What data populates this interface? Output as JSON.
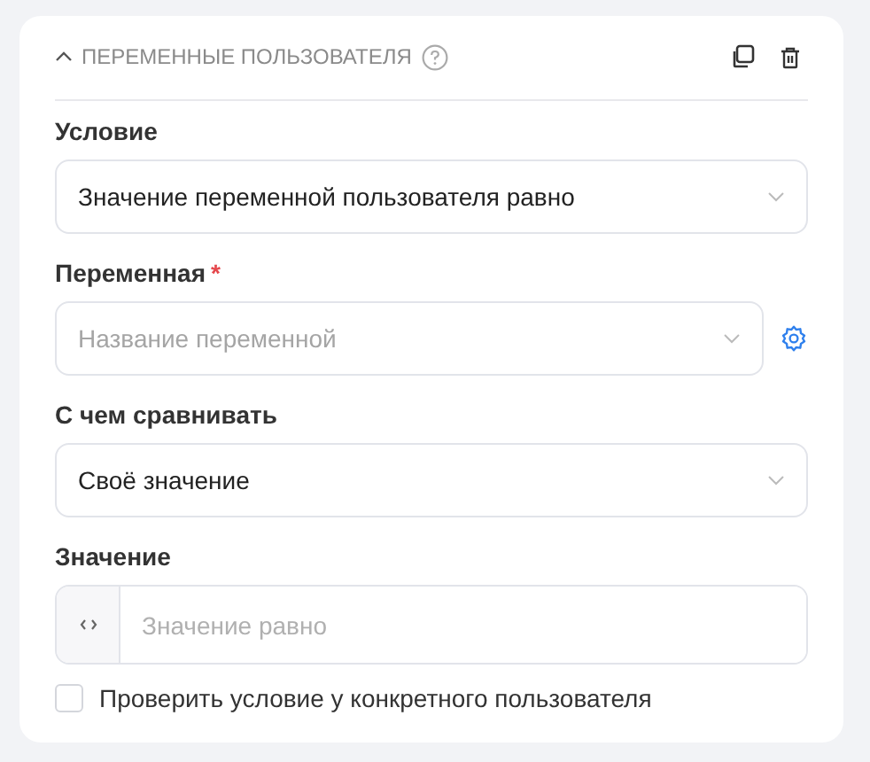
{
  "section": {
    "title": "ПЕРЕМЕННЫЕ ПОЛЬЗОВАТЕЛЯ",
    "expanded": true
  },
  "fields": [
    {
      "kind": "select",
      "label": "Условие",
      "value": "Значение переменной пользователя равно"
    },
    {
      "kind": "select",
      "label": "Переменная",
      "required_mark": "*",
      "placeholder": "Название переменной",
      "settings": true
    },
    {
      "kind": "select",
      "label": "С чем сравнивать",
      "value": "Своё значение"
    },
    {
      "kind": "code",
      "label": "Значение",
      "placeholder": "Значение равно"
    }
  ],
  "check": {
    "label": "Проверить условие у конкретного пользователя",
    "checked": false
  }
}
